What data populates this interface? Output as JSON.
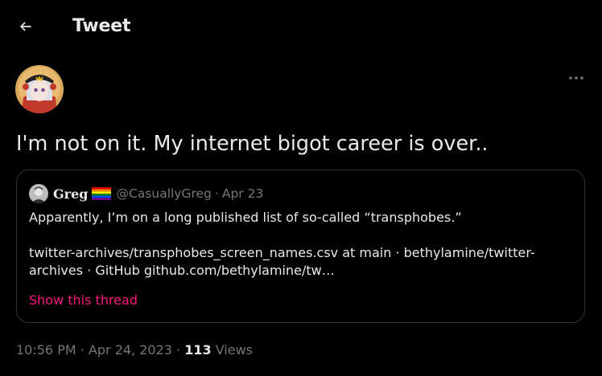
{
  "header": {
    "back_icon": "arrow-left-icon",
    "title": "Tweet"
  },
  "tweet": {
    "avatar_icon": "avatar-anime-character",
    "more_icon": "more-horizontal-icon",
    "text": "I'm not on it. My internet bigot career is over.."
  },
  "quote": {
    "avatar_icon": "avatar-portrait",
    "name": "Greg",
    "flag_icon": "rainbow-flag-emoji",
    "handle": "@CasuallyGreg",
    "separator": "·",
    "date": "Apr 23",
    "text": "Apparently, I’m on a long published list of so-called “transphobes.”",
    "link_text": "twitter-archives/transphobes_screen_names.csv at main · bethylamine/twitter-archives · GitHub github.com/bethylamine/tw…",
    "show_thread": "Show this thread"
  },
  "meta": {
    "time": "10:56 PM",
    "sep1": " · ",
    "date": "Apr 24, 2023",
    "sep2": " · ",
    "views_count": "113",
    "views_label": " Views"
  },
  "colors": {
    "background": "#000000",
    "text_primary": "#e7e9ea",
    "text_secondary": "#71767b",
    "border": "#2f3336",
    "accent_link": "#f91880"
  }
}
